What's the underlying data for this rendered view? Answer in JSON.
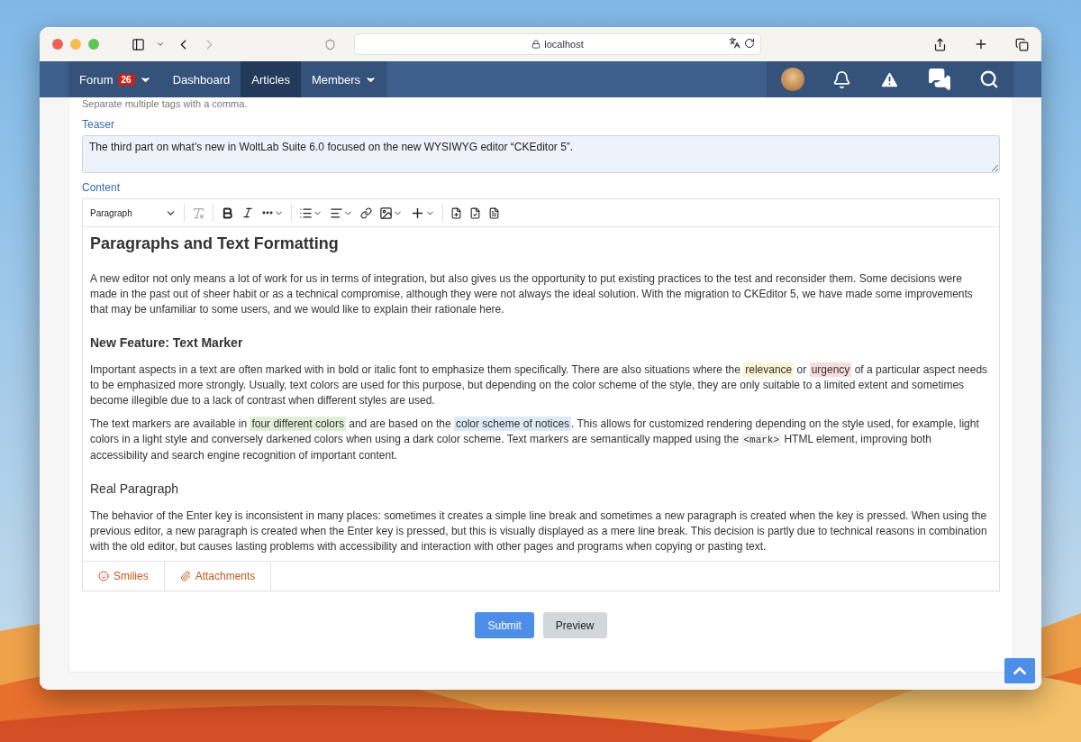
{
  "browser": {
    "url": "localhost"
  },
  "nav": {
    "items": [
      {
        "label": "Forum",
        "badge": "26",
        "dropdown": true,
        "selected": false
      },
      {
        "label": "Dashboard",
        "dropdown": false,
        "selected": false
      },
      {
        "label": "Articles",
        "dropdown": false,
        "selected": true
      },
      {
        "label": "Members",
        "dropdown": true,
        "selected": false
      }
    ]
  },
  "form": {
    "tags_hint": "Separate multiple tags with a comma.",
    "teaser": {
      "label": "Teaser",
      "value": "The third part on what’s new in WoltLab Suite 6.0 focused on the new WYSIWYG editor “CKEditor 5”."
    },
    "content": {
      "label": "Content",
      "toolbar": {
        "format": "Paragraph",
        "remove_format_disabled": true
      },
      "blocks": [
        {
          "kind": "h2",
          "segments": [
            {
              "kind": "plain",
              "text": "Paragraphs and Text Formatting"
            }
          ]
        },
        {
          "kind": "p",
          "segments": [
            {
              "kind": "plain",
              "text": "A new editor not only means a lot of work for us in terms of integration, but also gives us the opportunity to put existing practices to the test and reconsider them. Some decisions were made in the past out of sheer habit or as a technical compromise, although they were not always the ideal solution. With the migration to CKEditor 5, we have made some improvements that may be unfamiliar to some users, and we would like to explain their rationale here."
            }
          ]
        },
        {
          "kind": "h3",
          "segments": [
            {
              "kind": "plain",
              "text": "New Feature: Text Marker"
            }
          ]
        },
        {
          "kind": "p",
          "segments": [
            {
              "kind": "plain",
              "text": "Important aspects in a text are often marked with in bold or italic font to emphasize them specifically. There are also situations where the "
            },
            {
              "kind": "mark",
              "text": "relevance",
              "color": "#fbf3d5"
            },
            {
              "kind": "plain",
              "text": " or "
            },
            {
              "kind": "mark",
              "text": "urgency",
              "color": "#f6dcdc"
            },
            {
              "kind": "plain",
              "text": " of a particular aspect needs to be emphasized more strongly. Usually, text colors are used for this purpose, but depending on the color scheme of the style, they are only suitable to a limited extent and sometimes become illegible due to a lack of contrast when different styles are used."
            }
          ]
        },
        {
          "kind": "p",
          "segments": [
            {
              "kind": "plain",
              "text": "The text markers are available in "
            },
            {
              "kind": "mark",
              "text": "four different colors",
              "color": "#e0f0d8"
            },
            {
              "kind": "plain",
              "text": " and are based on the "
            },
            {
              "kind": "mark",
              "text": "color scheme of notices",
              "color": "#dde9f5"
            },
            {
              "kind": "plain",
              "text": ". This allows for customized rendering depending on the style used, for example, light colors in a light style and conversely darkened colors when using a dark color scheme. Text markers are semantically mapped using the "
            },
            {
              "kind": "code",
              "text": "<mark>"
            },
            {
              "kind": "plain",
              "text": " HTML element, improving both accessibility and search engine recognition of important content."
            }
          ]
        },
        {
          "kind": "h4",
          "segments": [
            {
              "kind": "plain",
              "text": "Real Paragraph"
            }
          ]
        },
        {
          "kind": "p",
          "segments": [
            {
              "kind": "plain",
              "text": "The behavior of the Enter key is inconsistent in many places: sometimes it creates a simple line break and sometimes a new paragraph is created when the key is pressed. When using the previous editor, a new paragraph is created when the Enter key is pressed, but this is visually displayed as a mere line break. This decision is partly due to technical reasons in combination with the old editor, but causes lasting problems with accessibility and interaction with other pages and programs when copying or pasting text."
            }
          ]
        }
      ],
      "tabs": [
        {
          "kind": "smilies",
          "label": "Smilies",
          "selected": false
        },
        {
          "kind": "attachments",
          "label": "Attachments",
          "selected": false
        }
      ]
    },
    "buttons": [
      {
        "kind": "primary",
        "label": "Submit"
      },
      {
        "kind": "secondary",
        "label": "Preview"
      }
    ]
  }
}
